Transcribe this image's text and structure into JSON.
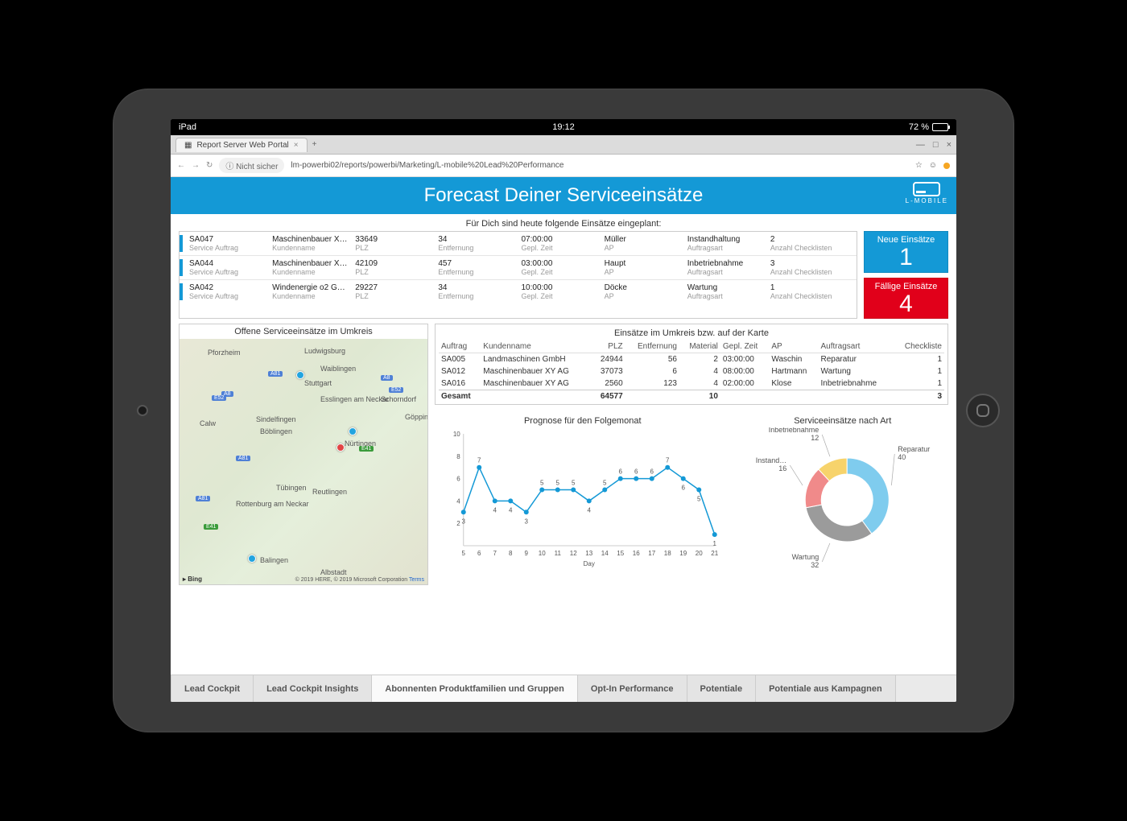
{
  "status": {
    "device": "iPad",
    "time": "19:12",
    "battery_pct": "72 %"
  },
  "browser": {
    "tab_title": "Report Server Web Portal",
    "insecure": "Nicht sicher",
    "url": "lm-powerbi02/reports/powerbi/Marketing/L-mobile%20Lead%20Performance"
  },
  "header": {
    "title": "Forecast Deiner Serviceeinsätze",
    "brand": "L-MOBILE"
  },
  "today_line": "Für Dich sind heute folgende Einsätze eingeplant:",
  "labels": {
    "sa": "Service Auftrag",
    "kn": "Kundenname",
    "plz": "PLZ",
    "ent": "Entfernung",
    "gz": "Gepl. Zeit",
    "ap": "AP",
    "art": "Auftragsart",
    "chk": "Anzahl Checklisten"
  },
  "plan": [
    {
      "id": "SA047",
      "kn": "Maschinenbauer X…",
      "plz": "33649",
      "ent": "34",
      "gz": "07:00:00",
      "ap": "Müller",
      "art": "Instandhaltung",
      "chk": "2"
    },
    {
      "id": "SA044",
      "kn": "Maschinenbauer X…",
      "plz": "42109",
      "ent": "457",
      "gz": "03:00:00",
      "ap": "Haupt",
      "art": "Inbetriebnahme",
      "chk": "3"
    },
    {
      "id": "SA042",
      "kn": "Windenergie o2 G…",
      "plz": "29227",
      "ent": "34",
      "gz": "10:00:00",
      "ap": "Döcke",
      "art": "Wartung",
      "chk": "1"
    }
  ],
  "kpi": {
    "neue_t": "Neue Einsätze",
    "neue_n": "1",
    "faellig_t": "Fällige Einsätze",
    "faellig_n": "4"
  },
  "map": {
    "title": "Offene Serviceeinsätze im Umkreis",
    "bing": "Bing",
    "copy": "© 2019 HERE, © 2019 Microsoft Corporation",
    "terms": "Terms",
    "cities": [
      "Pforzheim",
      "Ludwigsburg",
      "Waiblingen",
      "Stuttgart",
      "Esslingen am Neckar",
      "Schorndorf",
      "Göpping",
      "Calw",
      "Sindelfingen",
      "Böblingen",
      "Nürtingen",
      "Tübingen",
      "Reutlingen",
      "Rottenburg am Neckar",
      "Balingen",
      "Albstadt"
    ]
  },
  "umkreis": {
    "title": "Einsätze im Umkreis bzw. auf der Karte",
    "headers": [
      "Auftrag",
      "Kundenname",
      "PLZ",
      "Entfernung",
      "Material",
      "Gepl. Zeit",
      "AP",
      "Auftragsart",
      "Checkliste"
    ],
    "rows": [
      [
        "SA005",
        "Landmaschinen GmbH",
        "24944",
        "56",
        "2",
        "03:00:00",
        "Waschin",
        "Reparatur",
        "1"
      ],
      [
        "SA012",
        "Maschinenbauer XY AG",
        "37073",
        "6",
        "4",
        "08:00:00",
        "Hartmann",
        "Wartung",
        "1"
      ],
      [
        "SA016",
        "Maschinenbauer XY AG",
        "2560",
        "123",
        "4",
        "02:00:00",
        "Klose",
        "Inbetriebnahme",
        "1"
      ]
    ],
    "total_label": "Gesamt",
    "total_plz": "64577",
    "total_mat": "10",
    "total_chk": "3"
  },
  "chart_data": [
    {
      "type": "line",
      "title": "Prognose für den Folgemonat",
      "xlabel": "Day",
      "x": [
        5,
        6,
        7,
        8,
        9,
        10,
        11,
        12,
        13,
        14,
        15,
        16,
        17,
        18,
        19,
        20,
        21
      ],
      "values": [
        3,
        7,
        4,
        4,
        3,
        5,
        5,
        5,
        4,
        5,
        6,
        6,
        6,
        7,
        6,
        5,
        1
      ],
      "ylim": [
        0,
        10
      ],
      "yticks": [
        2,
        4,
        6,
        8,
        10
      ]
    },
    {
      "type": "pie",
      "title": "Serviceeinsätze nach Art",
      "slices": [
        {
          "name": "Reparatur",
          "value": 40,
          "color": "#7fccee"
        },
        {
          "name": "Wartung",
          "value": 32,
          "color": "#9b9b9b"
        },
        {
          "name": "Instand…",
          "value": 16,
          "color": "#f08a8a"
        },
        {
          "name": "Inbetriebnahme",
          "value": 12,
          "color": "#f7d36b"
        }
      ]
    }
  ],
  "bottom_tabs": [
    "Lead Cockpit",
    "Lead Cockpit Insights",
    "Abonnenten Produktfamilien und Gruppen",
    "Opt-In Performance",
    "Potentiale",
    "Potentiale aus Kampagnen"
  ],
  "bottom_active": 2
}
